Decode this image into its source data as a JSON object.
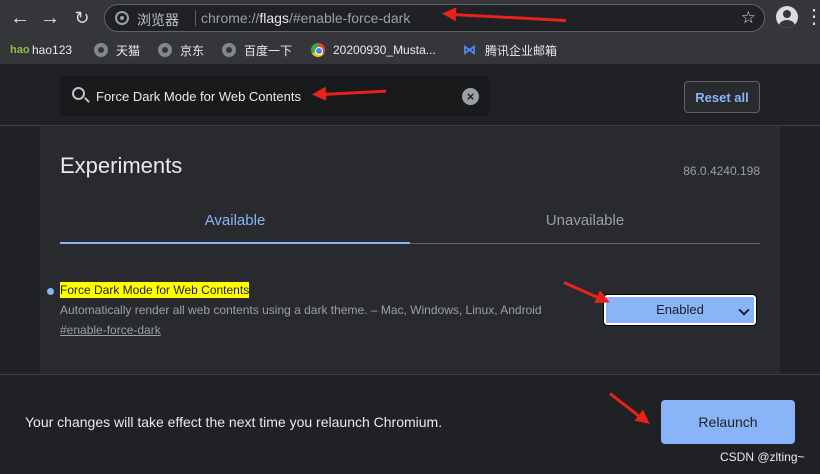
{
  "toolbar": {
    "back_icon": "arrow-left-icon",
    "forward_icon": "arrow-right-icon",
    "reload_icon": "reload-icon",
    "omnibox": {
      "site_label": "浏览器",
      "url_prefix": "chrome://",
      "url_highlight": "flags",
      "url_suffix": "/#enable-force-dark"
    },
    "star_icon": "star-icon",
    "profile_icon": "profile-icon",
    "menu_icon": "menu-icon"
  },
  "bookmarks": [
    {
      "label": "hao123",
      "icon": "hao123-icon"
    },
    {
      "label": "天猫",
      "icon": "globe-icon"
    },
    {
      "label": "京东",
      "icon": "globe-icon"
    },
    {
      "label": "百度一下",
      "icon": "globe-icon"
    },
    {
      "label": "20200930_Musta...",
      "icon": "chrome-icon"
    },
    {
      "label": "腾讯企业邮箱",
      "icon": "tencent-mail-icon"
    }
  ],
  "flags_header": {
    "search_value": "Force Dark Mode for Web Contents",
    "reset_label": "Reset all"
  },
  "main": {
    "title": "Experiments",
    "version": "86.0.4240.198",
    "tabs": [
      {
        "label": "Available",
        "active": true
      },
      {
        "label": "Unavailable",
        "active": false
      }
    ],
    "flag": {
      "name": "Force Dark Mode for Web Contents",
      "description": "Automatically render all web contents using a dark theme. – Mac, Windows, Linux, Android",
      "link": "#enable-force-dark",
      "selected_value": "Enabled"
    }
  },
  "relaunch": {
    "message": "Your changes will take effect the next time you relaunch Chromium.",
    "button_label": "Relaunch"
  },
  "watermark": "CSDN @zlting~",
  "colors": {
    "accent": "#8ab4f8",
    "highlight": "#ffff00",
    "annotation": "#e8221b",
    "background": "#202124"
  }
}
